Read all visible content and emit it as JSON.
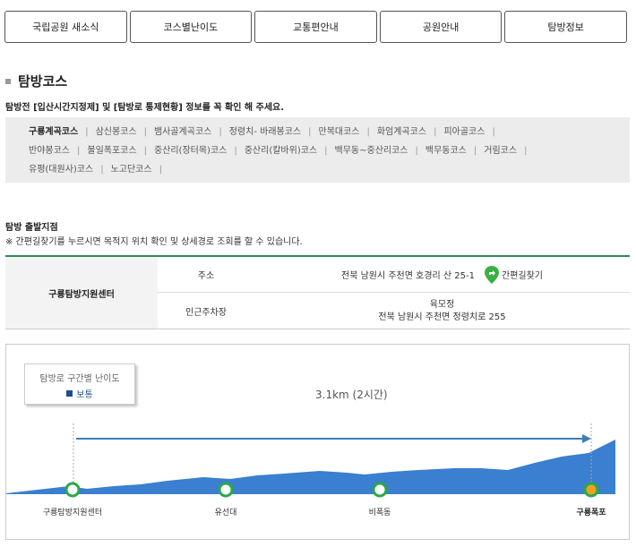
{
  "tabs": [
    "국립공원 새소식",
    "코스별난이도",
    "교통편안내",
    "공원안내",
    "탐방정보"
  ],
  "section_title": "탐방코스",
  "notice": "탐방전 [입산시간지정제] 및 [탐방로 통제현황] 정보를 꼭 확인 해 주세요.",
  "courses": {
    "line1": [
      "구룡계곡코스",
      "삼신봉코스",
      "뱀사골계곡코스",
      "정령치- 바래봉코스",
      "만복대코스",
      "화엄계곡코스",
      "피아골코스"
    ],
    "line2": [
      "반야봉코스",
      "불일폭포코스",
      "중산리(장터목)코스",
      "중산리(칼바위)코스",
      "백무동~중산리코스",
      "백무동코스",
      "거림코스"
    ],
    "line3": [
      "유평(대원사)코스",
      "노고단코스"
    ],
    "active": "구룡계곡코스"
  },
  "start": {
    "title": "탐방 출발지점",
    "note": "※ 간편길찾기를 누르시면 목적지 위치 확인 및 상세경로 조회를 할 수 있습니다.",
    "center": "구룡탐방지원센터",
    "address_label": "주소",
    "address": "전북 남원시 주천면 호경리 산 25-1",
    "find_label": "간편길찾기",
    "parking_label": "인근주차장",
    "parking_name": "육모정",
    "parking_address": "전북 남원시 주천면 정령치로 255"
  },
  "legend": {
    "title": "탐방로 구간별 난이도",
    "level": "보통",
    "color": "#1f4e8c"
  },
  "distance": "3.1km (2시간)",
  "stops": [
    {
      "name": "구룡탐방지원센터",
      "highlight": false
    },
    {
      "name": "유선대",
      "highlight": false
    },
    {
      "name": "비폭동",
      "highlight": false
    },
    {
      "name": "구룡폭포",
      "highlight": true
    }
  ],
  "colors": {
    "terrain": "#3a7fd0",
    "arrow": "#3a7fb5",
    "stop_ring": "#2aa84a",
    "stop_end": "#f0a020",
    "accent_border": "#2e8b57"
  }
}
